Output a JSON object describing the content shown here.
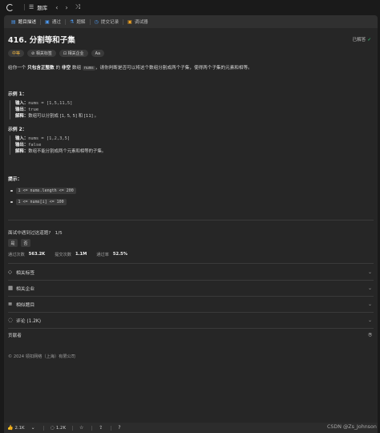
{
  "topbar": {
    "title": "题库"
  },
  "tabs": [
    {
      "label": "题目描述",
      "icon": "doc-icon"
    },
    {
      "label": "通过",
      "icon": "check-icon"
    },
    {
      "label": "题解",
      "icon": "flask-icon"
    },
    {
      "label": "提交记录",
      "icon": "history-icon"
    },
    {
      "label": "调试器",
      "icon": "debug-icon"
    }
  ],
  "problem": {
    "title": "416. 分割等和子集",
    "solved": "已解答",
    "tags": {
      "difficulty": "中等",
      "related": "相关标签",
      "company": "相关企业",
      "font": "Aa"
    },
    "desc_pre": "给你一个 ",
    "desc_bold": "只包含正整数",
    "desc_mid": " 的 ",
    "desc_bold2": "非空",
    "desc_mid2": " 数组 ",
    "desc_code": "nums",
    "desc_post": "，请你判断是否可以将这个数组分割成两个子集，使得两个子集的元素和相等。"
  },
  "examples": [
    {
      "title": "示例 1：",
      "input_label": "输入：",
      "input": "nums = [1,5,11,5]",
      "output_label": "输出：",
      "output": "true",
      "explain_label": "解释：",
      "explain": "数组可以分割成 [1, 5, 5] 和 [11] 。"
    },
    {
      "title": "示例 2：",
      "input_label": "输入：",
      "input": "nums = [1,2,3,5]",
      "output_label": "输出：",
      "output": "false",
      "explain_label": "解释：",
      "explain": "数组不能分割成两个元素和相等的子集。"
    }
  ],
  "hints": {
    "title": "提示：",
    "items": [
      "1 <= nums.length <= 200",
      "1 <= nums[i] <= 100"
    ]
  },
  "interview": {
    "question": "面试中遇到过这道题?",
    "count": "1/5",
    "yes": "是",
    "no": "否"
  },
  "stats": [
    {
      "label": "通过次数",
      "value": "563.2K"
    },
    {
      "label": "提交次数",
      "value": "1.1M"
    },
    {
      "label": "通过率",
      "value": "52.5%"
    }
  ],
  "sections": [
    {
      "label": "相关标签",
      "icon": "tag-icon"
    },
    {
      "label": "相关企业",
      "icon": "building-icon"
    },
    {
      "label": "相似题目",
      "icon": "list-icon"
    },
    {
      "label": "评论 (1.2K)",
      "icon": "comment-icon"
    }
  ],
  "contributors": "贡献者",
  "copyright": "© 2024 领扣网络（上海）有限公司",
  "bottombar": {
    "likes": "2.1K",
    "comments": "1.2K"
  },
  "watermark": "CSDN @Zs_Johnson"
}
